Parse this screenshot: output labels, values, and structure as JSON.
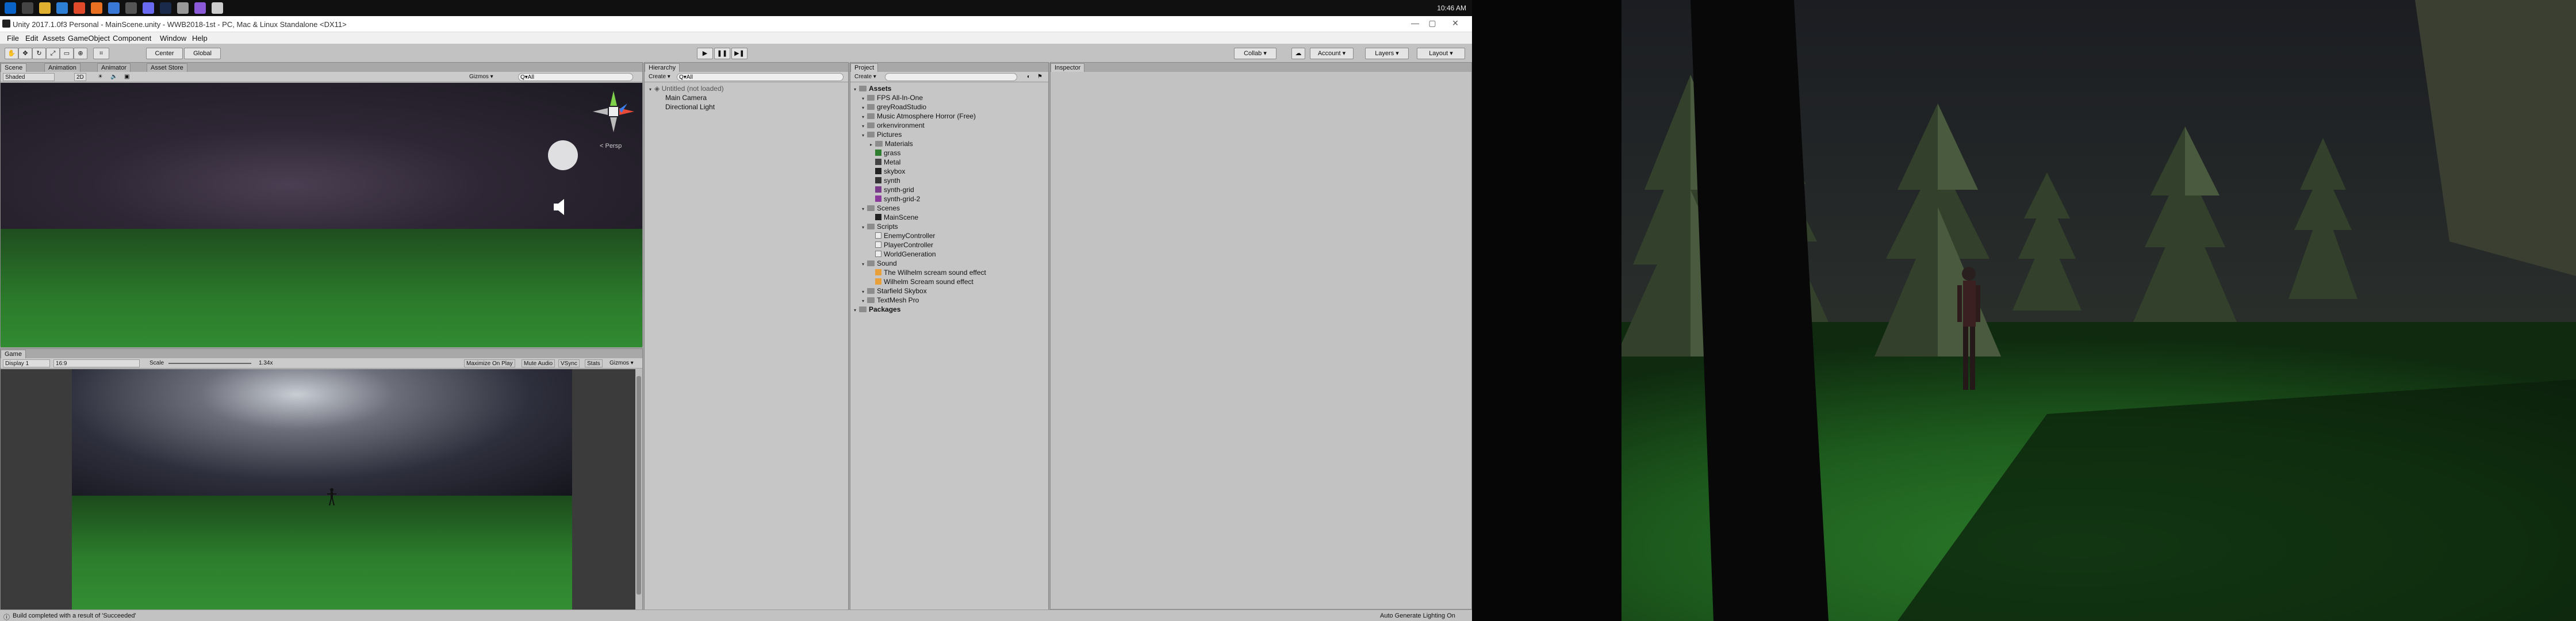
{
  "taskbar": {
    "clock": "10:46 AM",
    "icons": [
      "windows-start-icon",
      "task-view-icon",
      "file-explorer-icon",
      "edge-browser-icon",
      "chrome-icon",
      "firefox-icon",
      "mail-icon",
      "store-icon",
      "discord-icon",
      "steam-icon",
      "unity-icon",
      "visual-studio-icon",
      "app-icon"
    ]
  },
  "window": {
    "title": "Unity 2017.1.0f3 Personal - MainScene.unity - WWB2018-1st - PC, Mac & Linux Standalone <DX11>",
    "minimize": "—",
    "maximize": "▢",
    "close": "✕"
  },
  "menu": [
    "File",
    "Edit",
    "Assets",
    "GameObject",
    "Component",
    "Window",
    "Help"
  ],
  "toolbar": {
    "center": "Center",
    "global": "Global",
    "play": "▶",
    "pause": "❚❚",
    "step": "▶❚",
    "collab": "Collab ▾",
    "cloud": "☁",
    "account": "Account ▾",
    "layers": "Layers ▾",
    "layout": "Layout ▾"
  },
  "scene_panel": {
    "tabs": [
      "Scene",
      "Animation",
      "Animator",
      "Asset Store"
    ],
    "shaded": "Shaded",
    "mode_2d": "2D",
    "gizmos": "Gizmos ▾",
    "search": "Q▾All",
    "persp": "< Persp"
  },
  "game_panel": {
    "tab": "Game",
    "display": "Display 1",
    "aspect": "16:9",
    "scale_label": "Scale",
    "scale_value": "1.34x",
    "maximize_on_play": "Maximize On Play",
    "mute_audio": "Mute Audio",
    "stats": "Stats",
    "gizmos": "Gizmos ▾",
    "vsync": "VSync"
  },
  "hierarchy": {
    "tab": "Hierarchy",
    "create": "Create ▾",
    "search": "Q▾All",
    "scene": "Untitled (not loaded)",
    "items": [
      "Main Camera",
      "Directional Light"
    ]
  },
  "project": {
    "tab": "Project",
    "create": "Create ▾",
    "tree": [
      {
        "label": "Assets",
        "depth": 0,
        "bold": true,
        "kind": "folder"
      },
      {
        "label": "FPS All-In-One",
        "depth": 1,
        "kind": "folder"
      },
      {
        "label": "greyRoadStudio",
        "depth": 1,
        "kind": "folder"
      },
      {
        "label": "Music Atmosphere Horror (Free)",
        "depth": 1,
        "kind": "folder"
      },
      {
        "label": "orkenvironment",
        "depth": 1,
        "kind": "folder"
      },
      {
        "label": "Pictures",
        "depth": 1,
        "kind": "folder"
      },
      {
        "label": "Materials",
        "depth": 2,
        "kind": "folder"
      },
      {
        "label": "grass",
        "depth": 2,
        "kind": "swatch",
        "color": "#2f7d2f"
      },
      {
        "label": "Metal",
        "depth": 2,
        "kind": "swatch",
        "color": "#444444"
      },
      {
        "label": "skybox",
        "depth": 2,
        "kind": "swatch",
        "color": "#222222"
      },
      {
        "label": "synth",
        "depth": 2,
        "kind": "swatch",
        "color": "#333333"
      },
      {
        "label": "synth-grid",
        "depth": 2,
        "kind": "swatch",
        "color": "#7a3a8a"
      },
      {
        "label": "synth-grid-2",
        "depth": 2,
        "kind": "swatch",
        "color": "#8a3a9a"
      },
      {
        "label": "Scenes",
        "depth": 1,
        "kind": "folder"
      },
      {
        "label": "MainScene",
        "depth": 2,
        "kind": "unity"
      },
      {
        "label": "Scripts",
        "depth": 1,
        "kind": "folder"
      },
      {
        "label": "EnemyController",
        "depth": 2,
        "kind": "script"
      },
      {
        "label": "PlayerController",
        "depth": 2,
        "kind": "script"
      },
      {
        "label": "WorldGeneration",
        "depth": 2,
        "kind": "script"
      },
      {
        "label": "Sound",
        "depth": 1,
        "kind": "folder"
      },
      {
        "label": "The Wilhelm scream sound effect",
        "depth": 2,
        "kind": "audio"
      },
      {
        "label": "Wilhelm Scream sound effect",
        "depth": 2,
        "kind": "audio"
      },
      {
        "label": "Starfield Skybox",
        "depth": 1,
        "kind": "folder"
      },
      {
        "label": "TextMesh Pro",
        "depth": 1,
        "kind": "folder"
      },
      {
        "label": "Packages",
        "depth": 0,
        "bold": true,
        "kind": "folder"
      }
    ]
  },
  "inspector": {
    "tab": "Inspector"
  },
  "status": {
    "message": "Build completed with a result of 'Succeeded'",
    "lighting": "Auto Generate Lighting On"
  },
  "colors": {
    "panel_bg": "#c2c2c2",
    "tab_bg": "#a8a8a8",
    "grass": "#2a6e2a",
    "sky": "#2e2836"
  }
}
